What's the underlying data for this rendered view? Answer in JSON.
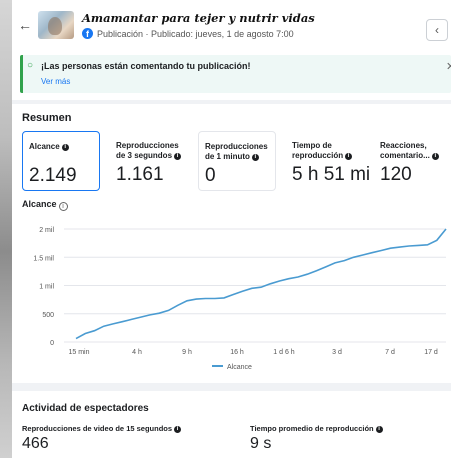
{
  "header": {
    "title": "Amamantar para tejer y nutrir vidas",
    "subtitle": "Publicación · Publicado: jueves, 1 de agosto 7:00",
    "back_icon": "arrow-left-icon",
    "collapse_icon": "chevron-left-icon"
  },
  "notification": {
    "text": "¡Las personas están comentando tu publicación!",
    "link": "Ver más",
    "icon": "lightbulb-icon"
  },
  "summary": {
    "title": "Resumen",
    "metrics": [
      {
        "label": "Alcance",
        "value": "2.149"
      },
      {
        "label": "Reproducciones de 3 segundos",
        "value": "1.161"
      },
      {
        "label": "Reproducciones de 1 minuto",
        "value": "0"
      },
      {
        "label": "Tiempo de reproducción",
        "value": "5 h 51 mi"
      },
      {
        "label": "Reacciones, comentario...",
        "value": "120"
      }
    ]
  },
  "reach_chart_title": "Alcance",
  "chart_data": {
    "type": "line",
    "title": "Alcance",
    "ylim": [
      0,
      2000
    ],
    "y_ticks": [
      "0",
      "500",
      "1 mil",
      "1.5 mil",
      "2 mil"
    ],
    "x_tick_labels": [
      "15 min",
      "4 h",
      "9 h",
      "16 h",
      "1 d 6 h",
      "3 d",
      "7 d",
      "17 d"
    ],
    "series": [
      {
        "name": "Alcance",
        "color": "#4a9bd1",
        "x_index": [
          0,
          1,
          2,
          3,
          4,
          5,
          6,
          7,
          8,
          9,
          10,
          11,
          12,
          13,
          14,
          15,
          16,
          17,
          18,
          19,
          20,
          21,
          22,
          23,
          24,
          25,
          26,
          27,
          28,
          29,
          30,
          31,
          32,
          33,
          34,
          35,
          36,
          37,
          38,
          39,
          40
        ],
        "values": [
          60,
          150,
          200,
          280,
          320,
          360,
          400,
          440,
          480,
          510,
          560,
          650,
          730,
          760,
          770,
          770,
          780,
          840,
          900,
          950,
          970,
          1030,
          1080,
          1120,
          1150,
          1200,
          1260,
          1330,
          1400,
          1440,
          1500,
          1540,
          1580,
          1620,
          1660,
          1680,
          1700,
          1710,
          1720,
          1800,
          2000
        ]
      }
    ]
  },
  "viewers": {
    "title": "Actividad de espectadores",
    "metrics": [
      {
        "label": "Reproducciones de video de 15 segundos",
        "value": "466"
      },
      {
        "label": "Tiempo promedio de reproducción",
        "value": "9 s"
      }
    ]
  }
}
